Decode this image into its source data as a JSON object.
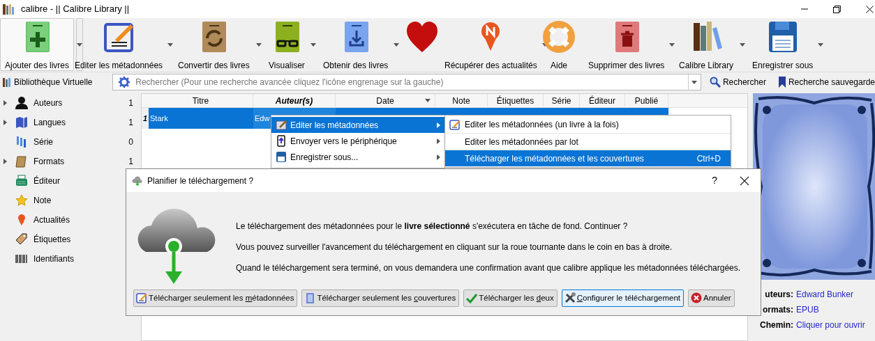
{
  "window": {
    "title": "calibre - || Calibre Library ||"
  },
  "toolbar": [
    {
      "label": "Ajouter des livres",
      "dropdown": true,
      "selected": true
    },
    {
      "label": "Editer les métadonnées",
      "dropdown": true,
      "selected": false
    },
    {
      "label": "Convertir des livres",
      "dropdown": true,
      "selected": false
    },
    {
      "label": "Visualiser",
      "dropdown": true,
      "selected": false
    },
    {
      "label": "Obtenir des livres",
      "dropdown": true,
      "selected": false
    },
    {
      "selected": false
    },
    {
      "label": "Récupérer des actualités",
      "dropdown": true,
      "selected": false
    },
    {
      "label": "Aide",
      "dropdown": false,
      "selected": false
    },
    {
      "label": "Supprimer des livres",
      "dropdown": true,
      "selected": false
    },
    {
      "label": "Calibre Library",
      "dropdown": true,
      "selected": false
    },
    {
      "label": "Enregistrer sous",
      "dropdown": true,
      "selected": false
    }
  ],
  "search_bar": {
    "virtual_library": "Bibliothèque Virtuelle",
    "placeholder": "Rechercher (Pour une recherche avancée cliquez l'icône engrenage sur la gauche)",
    "search_button": "Rechercher",
    "saved_search": "Recherche sauvegarde"
  },
  "sidebar": {
    "items": [
      {
        "label": "Auteurs",
        "count": "1",
        "expandable": true
      },
      {
        "label": "Langues",
        "count": "1",
        "expandable": true
      },
      {
        "label": "Série",
        "count": "0",
        "expandable": false
      },
      {
        "label": "Formats",
        "count": "1",
        "expandable": true
      },
      {
        "label": "Éditeur",
        "expandable": false
      },
      {
        "label": "Note",
        "expandable": false
      },
      {
        "label": "Actualités",
        "expandable": false
      },
      {
        "label": "Étiquettes",
        "expandable": false
      },
      {
        "label": "Identifiants",
        "expandable": false
      }
    ]
  },
  "table": {
    "columns": [
      {
        "label": "Titre",
        "highlighted": false,
        "sorted": false
      },
      {
        "label": "Auteur(s)",
        "highlighted": true,
        "sorted": false
      },
      {
        "label": "Date",
        "highlighted": false,
        "sorted": true
      },
      {
        "label": "Note",
        "highlighted": false,
        "sorted": false
      },
      {
        "label": "Étiquettes",
        "highlighted": false,
        "sorted": false
      },
      {
        "label": "Série",
        "highlighted": false,
        "sorted": false
      },
      {
        "label": "Éditeur",
        "highlighted": false,
        "sorted": false
      },
      {
        "label": "Publié",
        "highlighted": false,
        "sorted": false
      }
    ],
    "rows": [
      {
        "number": "1",
        "cells": [
          "Stark",
          "Edw"
        ],
        "selected": true
      }
    ]
  },
  "context_menu": {
    "items": [
      {
        "label": "Editer les métadonnées",
        "selected": true,
        "submenu": true
      },
      {
        "label": "Envoyer vers le périphérique",
        "selected": false,
        "submenu": true
      },
      {
        "label": "Enregistrer sous...",
        "selected": false,
        "submenu": true
      }
    ]
  },
  "submenu": {
    "items": [
      {
        "label": "Editer les métadonnées (un livre à la fois)",
        "selected": false
      },
      {
        "label": "Editer les métadonnées par lot",
        "selected": false
      },
      {
        "label": "Télécharger les métadonnées et les couvertures",
        "shortcut": "Ctrl+D",
        "selected": true
      }
    ]
  },
  "book_details": {
    "fields": [
      {
        "label": "uteurs:",
        "value": "Edward Bunker"
      },
      {
        "label": "ormats:",
        "value": "EPUB"
      },
      {
        "label": "Chemin:",
        "value": "Cliquer pour ouvrir"
      }
    ]
  },
  "dialog": {
    "title": "Planifier le téléchargement ?",
    "help": "?",
    "paragraphs": [
      "Le téléchargement des métadonnées pour le **livre sélectionné** s'exécutera en tâche de fond. Continuer ?",
      "Vous pouvez surveiller l'avancement du téléchargement en cliquant sur la roue tournante dans le coin en bas à droite.",
      "Quand le téléchargement sera terminé, on vous demandera une confirmation avant que calibre applique les métadonnées téléchargées."
    ],
    "buttons": [
      {
        "before": "Télécharger seulement les ",
        "mnemonic": "m",
        "after": "étadonnées",
        "focused": false
      },
      {
        "before": "Télécharger seulement les ",
        "mnemonic": "c",
        "after": "ouvertures",
        "focused": false
      },
      {
        "before": "Télécharger les ",
        "mnemonic": "d",
        "after": "eux",
        "focused": false
      },
      {
        "mnemonic": "C",
        "after": "onfigurer le téléchargement",
        "focused": true
      },
      {
        "before": "Annuler",
        "focused": false
      }
    ]
  }
}
